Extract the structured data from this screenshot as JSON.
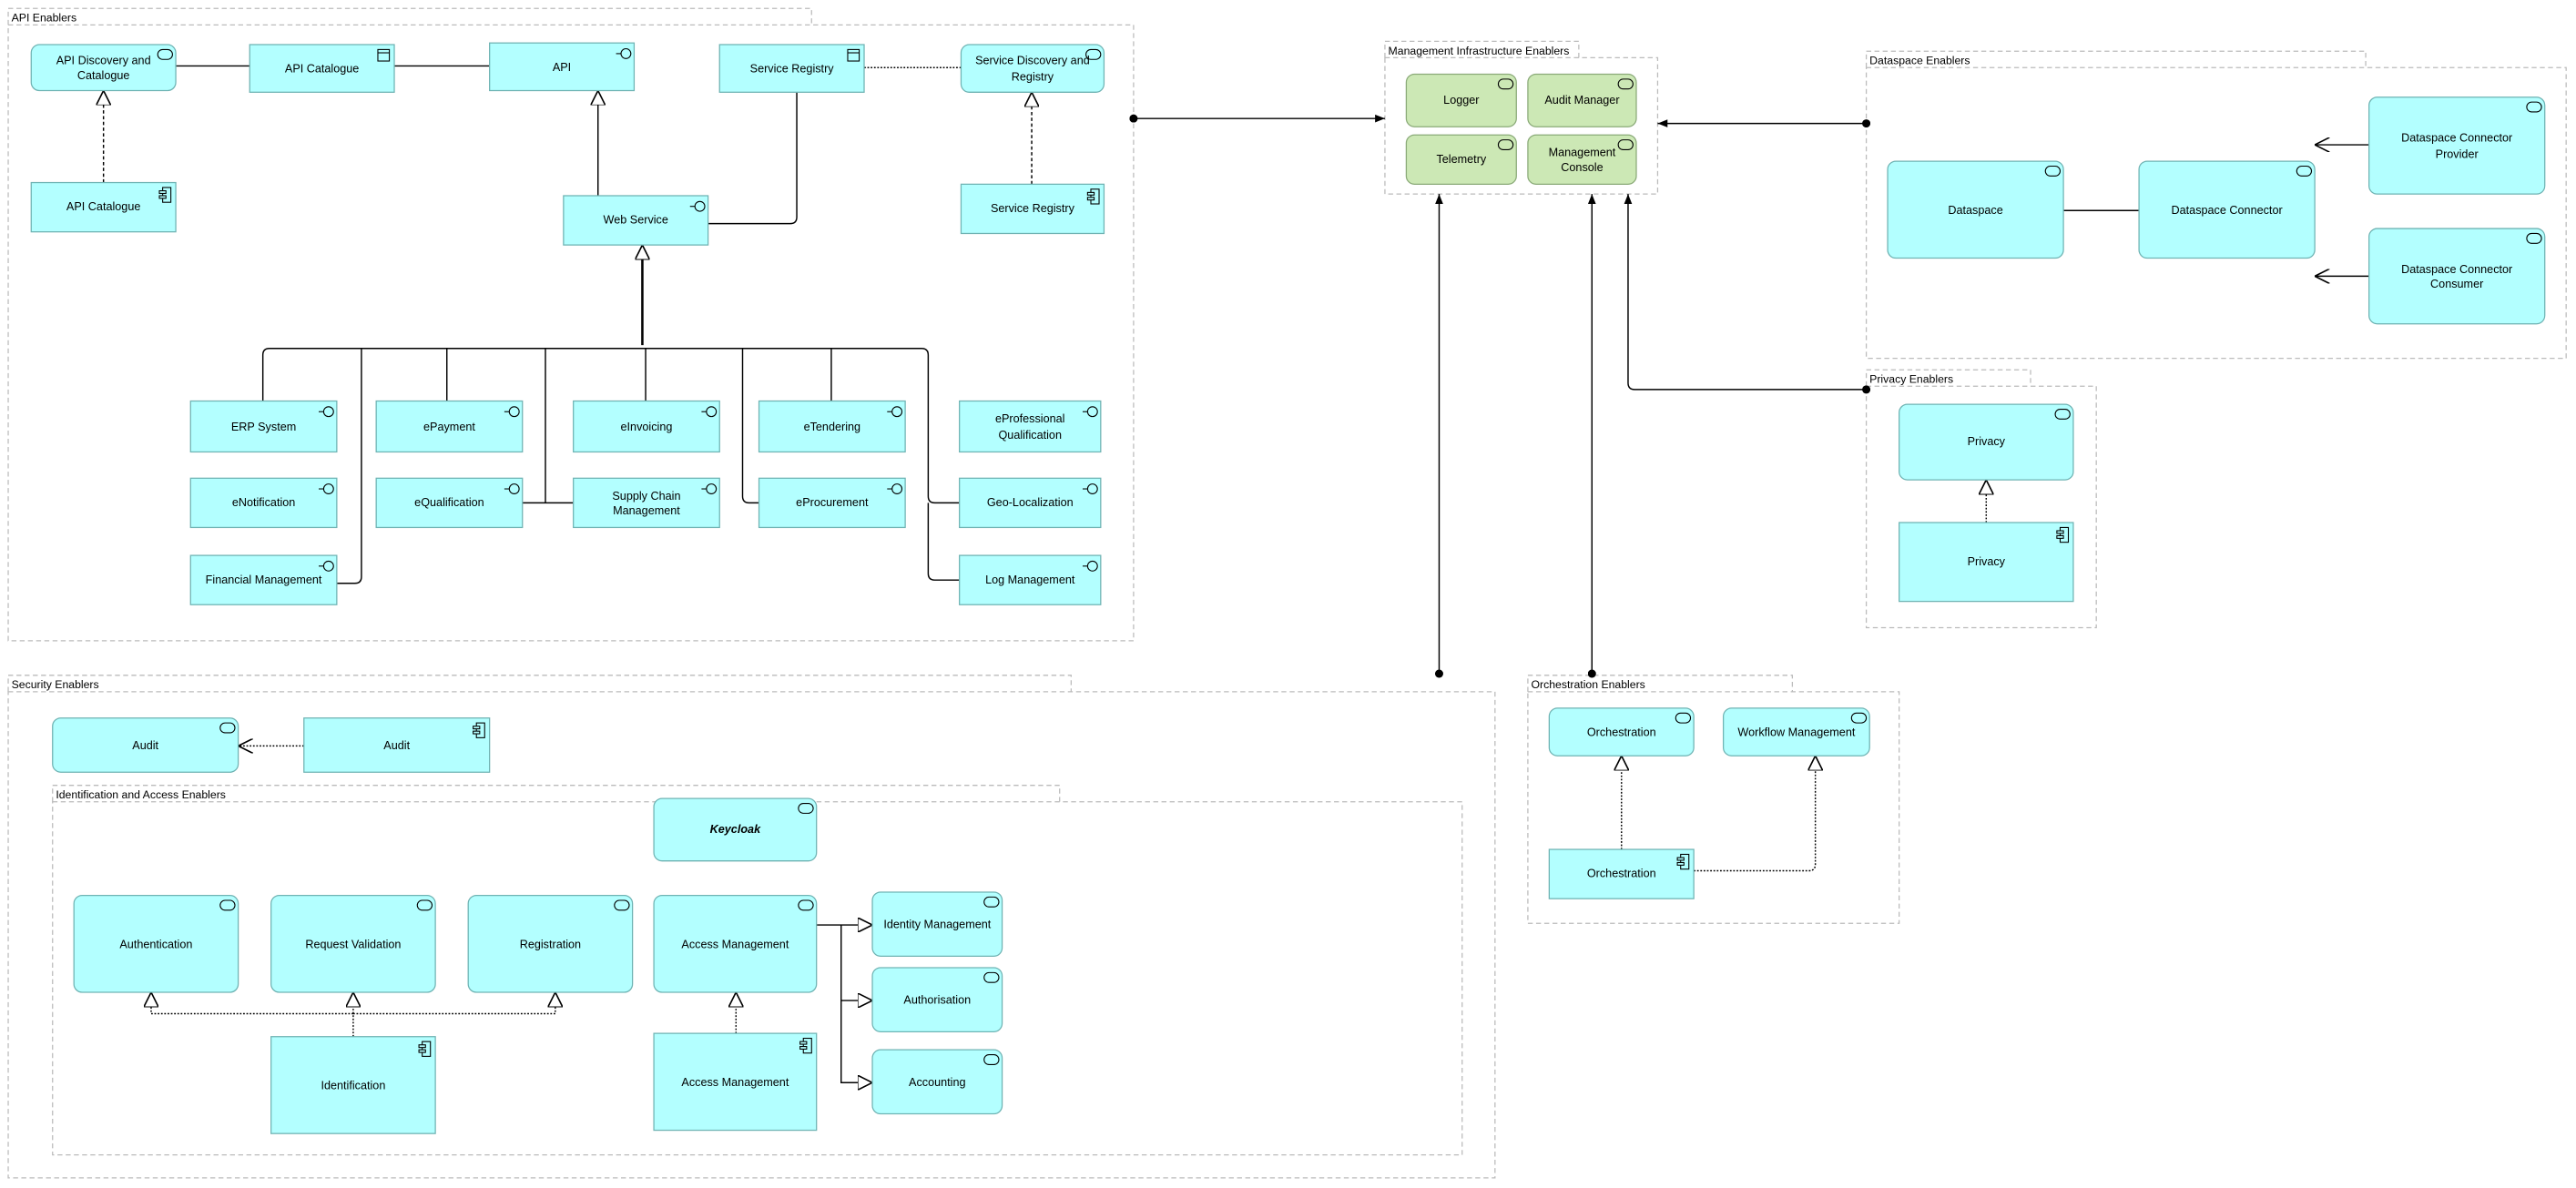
{
  "colors": {
    "app_fill": "#b3ffff",
    "app_stroke": "#6fb3b3",
    "tech_fill": "#cce8b5",
    "tech_stroke": "#8aaa78",
    "group_stroke": "#bbbbbb"
  },
  "groups": [
    {
      "id": "api",
      "label": "API Enablers"
    },
    {
      "id": "mgmt",
      "label": "Management Infrastructure Enablers"
    },
    {
      "id": "dataspace",
      "label": "Dataspace Enablers"
    },
    {
      "id": "privacy",
      "label": "Privacy Enablers"
    },
    {
      "id": "security",
      "label": "Security Enablers"
    },
    {
      "id": "iam",
      "label": "Identification and Access Enablers"
    },
    {
      "id": "orch",
      "label": "Orchestration Enablers"
    }
  ],
  "nodes": [
    {
      "id": "apidisc",
      "label": "API Discovery and Catalogue",
      "type": "service-icon"
    },
    {
      "id": "apicat",
      "label": "API Catalogue",
      "type": "data-object-icon"
    },
    {
      "id": "api",
      "label": "API",
      "type": "interface-icon"
    },
    {
      "id": "sreg",
      "label": "Service Registry",
      "type": "data-object-icon"
    },
    {
      "id": "sdisc",
      "label": "Service Discovery and Registry",
      "type": "service-icon"
    },
    {
      "id": "apicatc",
      "label": "API Catalogue",
      "type": "component-icon"
    },
    {
      "id": "websvc",
      "label": "Web Service",
      "type": "interface-icon"
    },
    {
      "id": "sregc",
      "label": "Service Registry",
      "type": "component-icon"
    },
    {
      "id": "erp",
      "label": "ERP System",
      "type": "interface-icon"
    },
    {
      "id": "epay",
      "label": "ePayment",
      "type": "interface-icon"
    },
    {
      "id": "einv",
      "label": "eInvoicing",
      "type": "interface-icon"
    },
    {
      "id": "eten",
      "label": "eTendering",
      "type": "interface-icon"
    },
    {
      "id": "eprof",
      "label": "eProfessional Qualification",
      "type": "interface-icon"
    },
    {
      "id": "enot",
      "label": "eNotification",
      "type": "interface-icon"
    },
    {
      "id": "equal",
      "label": "eQualification",
      "type": "interface-icon"
    },
    {
      "id": "scm",
      "label": "Supply Chain Management",
      "type": "interface-icon"
    },
    {
      "id": "eproc",
      "label": "eProcurement",
      "type": "interface-icon"
    },
    {
      "id": "geo",
      "label": "Geo-Localization",
      "type": "interface-icon"
    },
    {
      "id": "fin",
      "label": "Financial Management",
      "type": "interface-icon"
    },
    {
      "id": "logm",
      "label": "Log Management",
      "type": "interface-icon"
    },
    {
      "id": "logger",
      "label": "Logger",
      "type": "service-icon"
    },
    {
      "id": "auditm",
      "label": "Audit Manager",
      "type": "service-icon"
    },
    {
      "id": "telemetry",
      "label": "Telemetry",
      "type": "service-icon"
    },
    {
      "id": "mconsole",
      "label": "Management Console",
      "type": "service-icon"
    },
    {
      "id": "dataspace",
      "label": "Dataspace",
      "type": "service-icon"
    },
    {
      "id": "dsconn",
      "label": "Dataspace Connector",
      "type": "service-icon"
    },
    {
      "id": "dsprov",
      "label": "Dataspace Connector Provider",
      "type": "service-icon"
    },
    {
      "id": "dscons",
      "label": "Dataspace Connector Consumer",
      "type": "service-icon"
    },
    {
      "id": "privs",
      "label": "Privacy",
      "type": "service-icon"
    },
    {
      "id": "privc",
      "label": "Privacy",
      "type": "component-icon"
    },
    {
      "id": "audits",
      "label": "Audit",
      "type": "service-icon"
    },
    {
      "id": "auditc",
      "label": "Audit",
      "type": "component-icon"
    },
    {
      "id": "keycloak",
      "label": "Keycloak",
      "type": "service-icon"
    },
    {
      "id": "authn",
      "label": "Authentication",
      "type": "service-icon"
    },
    {
      "id": "reqval",
      "label": "Request Validation",
      "type": "service-icon"
    },
    {
      "id": "reg",
      "label": "Registration",
      "type": "service-icon"
    },
    {
      "id": "accm",
      "label": "Access Management",
      "type": "service-icon"
    },
    {
      "id": "idm",
      "label": "Identity Management",
      "type": "service-icon"
    },
    {
      "id": "authz",
      "label": "Authorisation",
      "type": "service-icon"
    },
    {
      "id": "acct",
      "label": "Accounting",
      "type": "service-icon"
    },
    {
      "id": "ident",
      "label": "Identification",
      "type": "component-icon"
    },
    {
      "id": "accmc",
      "label": "Access Management",
      "type": "component-icon"
    },
    {
      "id": "orchs",
      "label": "Orchestration",
      "type": "service-icon"
    },
    {
      "id": "wfm",
      "label": "Workflow Management",
      "type": "service-icon"
    },
    {
      "id": "orchc",
      "label": "Orchestration",
      "type": "component-icon"
    }
  ]
}
